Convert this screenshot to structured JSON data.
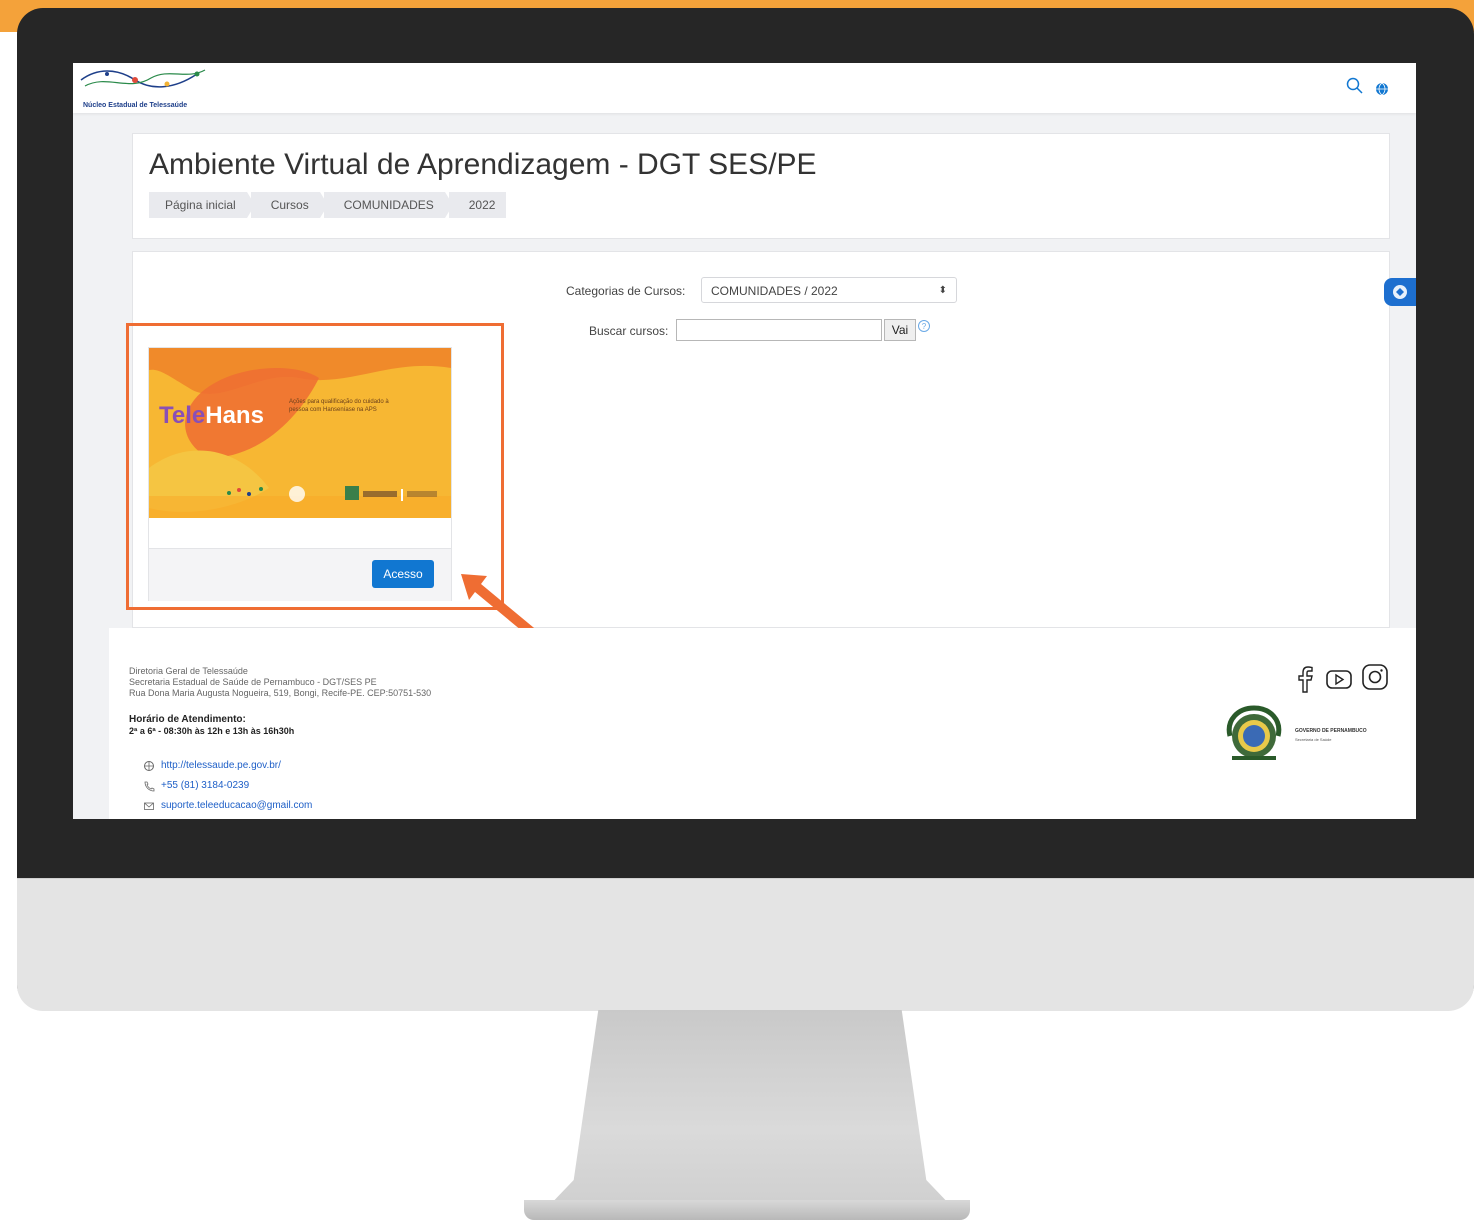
{
  "site": {
    "logo_text": "Núcleo Estadual de Telessaúde"
  },
  "header": {
    "title": "Ambiente Virtual de Aprendizagem - DGT SES/PE",
    "breadcrumb": [
      "Página inicial",
      "Cursos",
      "COMUNIDADES",
      "2022"
    ]
  },
  "filters": {
    "category_label": "Categorias de Cursos:",
    "category_selected": "COMUNIDADES / 2022",
    "search_label": "Buscar cursos:",
    "search_value": "",
    "search_button": "Vai"
  },
  "course": {
    "image_title_part1": "Tele",
    "image_title_part2": "Hans",
    "image_subtitle": "Ações para qualificação do cuidado à pessoa com Hanseníase na APS",
    "access_button": "Acesso"
  },
  "footer": {
    "org_lines": [
      "Diretoria Geral de Telessaúde",
      "Secretaria Estadual de Saúde de Pernambuco - DGT/SES PE",
      "Rua Dona Maria Augusta Nogueira, 519, Bongi, Recife-PE. CEP:50751-530"
    ],
    "hours_title": "Horário de Atendimento:",
    "hours": "2ª a 6ª - 08:30h às 12h e 13h às 16h30h",
    "website": "http://telessaude.pe.gov.br/",
    "phone": "+55 (81) 3184-0239",
    "email": "suporte.teleeducacao@gmail.com",
    "gov_name": "GOVERNO DE PERNAMBUCO",
    "gov_sub": "Secretaria de Saúde"
  },
  "colors": {
    "accent_orange": "#ef6d33",
    "primary_blue": "#1177d1",
    "course_bg": "#f7b733"
  },
  "icons": [
    "search-icon",
    "globe-icon",
    "help-icon",
    "facebook-icon",
    "youtube-icon",
    "instagram-icon",
    "web-icon",
    "phone-icon",
    "mail-icon",
    "arrow-icon"
  ]
}
